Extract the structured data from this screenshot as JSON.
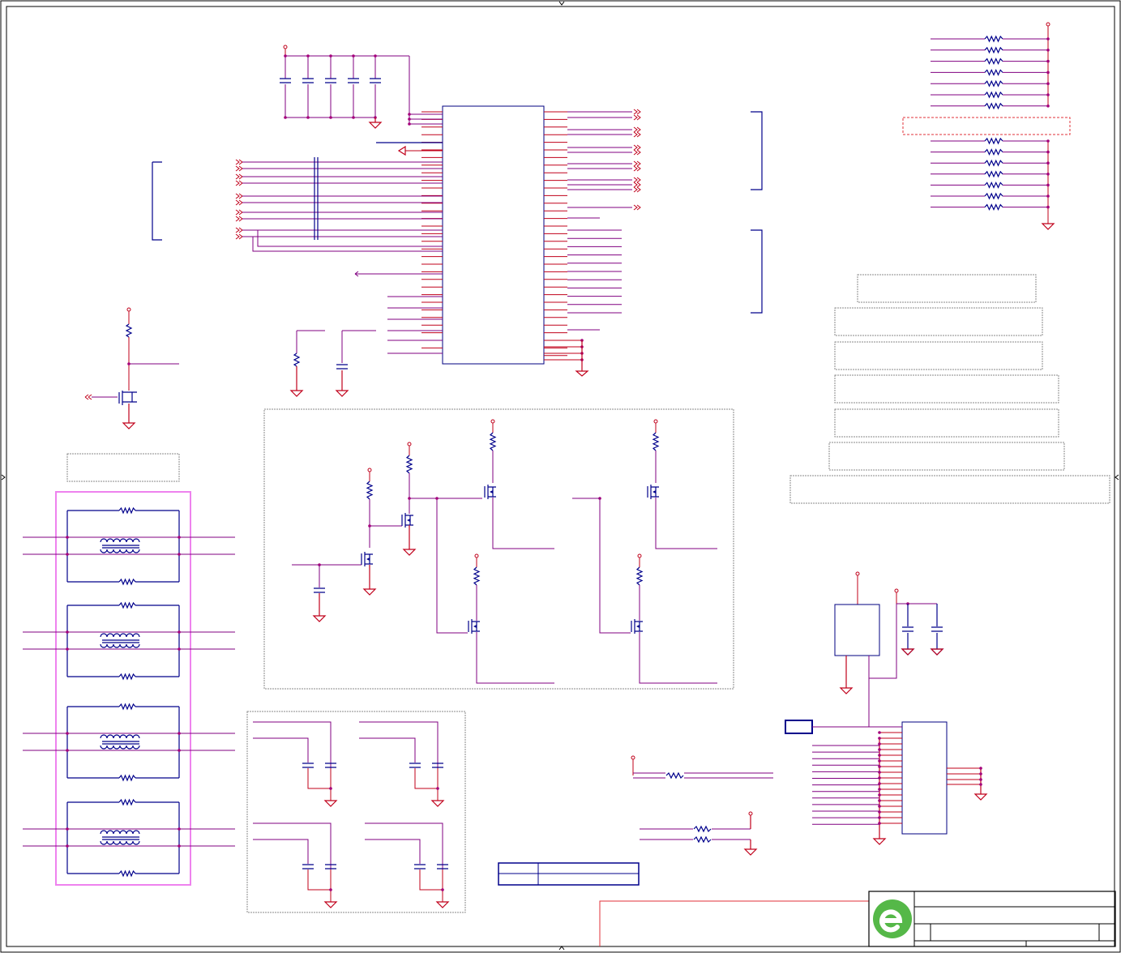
{
  "sheet": {
    "title_block": {
      "logo": "green-e-logo",
      "title": "",
      "fields": []
    },
    "revision_table": {
      "rows": [
        [
          "",
          ""
        ],
        [
          "",
          ""
        ]
      ]
    }
  },
  "colors": {
    "wire": "#c0001a",
    "component": "#00008b",
    "bus": "#800080",
    "net_dot": "#a4007a",
    "highlight_box": "#ee82ee",
    "dashed_red_box": "#e0303a",
    "logo_green": "#55b848"
  },
  "sections": [
    "decoupling-capacitors",
    "main-ic",
    "connector-brackets",
    "pullup-resistor-bank",
    "reset-mosfet",
    "ethernet-magnetics",
    "mosfet-driver-block",
    "filter-capacitor-block",
    "regulator",
    "header-connector",
    "notes"
  ]
}
